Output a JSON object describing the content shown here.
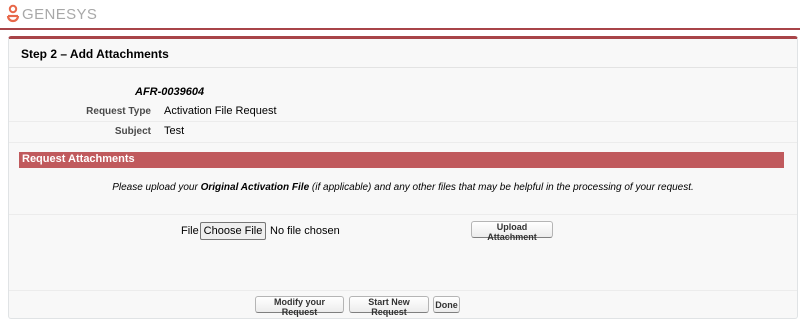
{
  "brand": {
    "name": "GENESYS",
    "accent_color": "#a84448",
    "section_color": "#c05a5d"
  },
  "step": {
    "title": "Step 2 – Add Attachments"
  },
  "request": {
    "number": "AFR-0039604",
    "type_label": "Request Type",
    "type_value": "Activation File Request",
    "subject_label": "Subject",
    "subject_value": "Test"
  },
  "attachments": {
    "section_title": "Request Attachments",
    "instruction_pre": "Please upload your ",
    "instruction_bold": "Original Activation File",
    "instruction_post": " (if applicable) and any other files that may be helpful in the processing of your request.",
    "file_label": "File",
    "choose_button": "Choose File",
    "no_file_text": "No file chosen",
    "upload_button": "Upload Attachment"
  },
  "footer": {
    "modify_button": "Modify your Request",
    "new_request_button": "Start New Request",
    "done_button": "Done"
  }
}
